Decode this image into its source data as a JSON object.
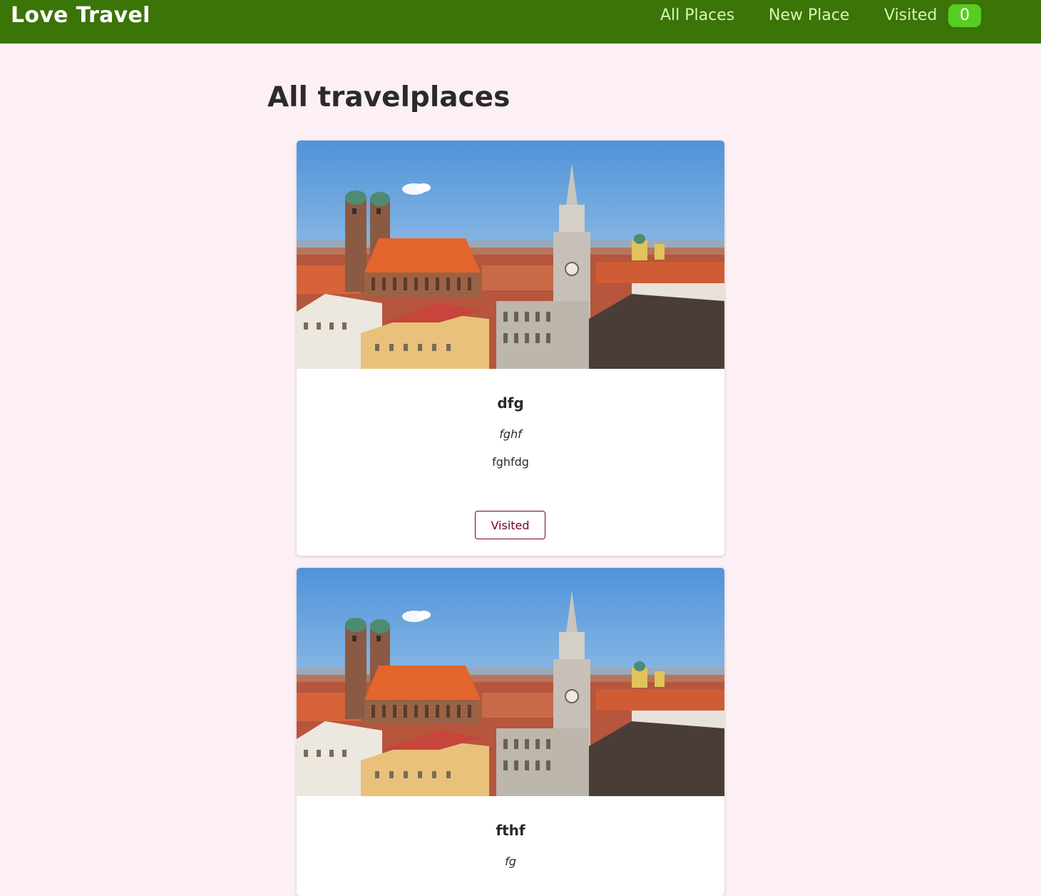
{
  "header": {
    "logo": "Love Travel",
    "nav": {
      "all_places": "All Places",
      "new_place": "New Place",
      "visited": "Visited",
      "visited_count": "0"
    }
  },
  "main": {
    "title": "All travelplaces",
    "places": [
      {
        "title": "dfg",
        "address": "fghf",
        "description": "fghfdg",
        "button_label": "Visited"
      },
      {
        "title": "fthf",
        "address": "fg"
      }
    ]
  },
  "colors": {
    "header_bg": "#3b7407",
    "nav_link": "#d9f5b6",
    "badge_bg": "#57cd20",
    "page_bg": "#fdf0f4",
    "button_accent": "#77002e"
  }
}
